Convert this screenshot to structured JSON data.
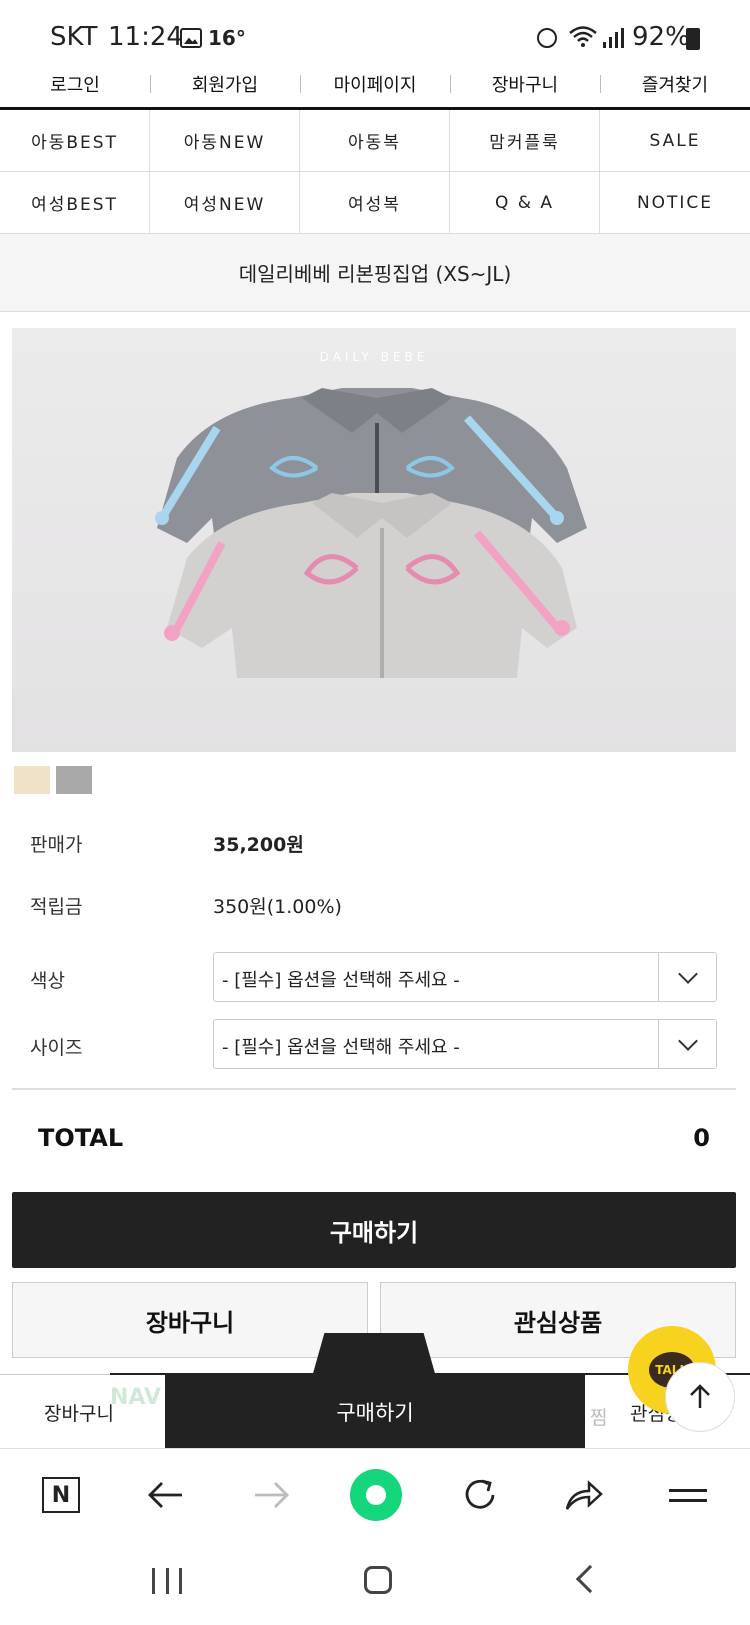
{
  "status_bar": {
    "carrier": "SKT",
    "time": "11:24",
    "temperature": "16°",
    "battery": "92%"
  },
  "top_links": [
    "로그인",
    "회원가입",
    "마이페이지",
    "장바구니",
    "즐겨찾기"
  ],
  "categories": [
    "아동BEST",
    "아동NEW",
    "아동복",
    "맘커플룩",
    "SALE",
    "여성BEST",
    "여성NEW",
    "여성복",
    "Q & A",
    "NOTICE"
  ],
  "product": {
    "title": "데일리베베 리본핑집업 (XS~JL)",
    "image_brand": "DAILY BEBE",
    "swatches": [
      "#efe2c9",
      "#a9a9a9"
    ],
    "price_label": "판매가",
    "price": "35,200원",
    "points_label": "적립금",
    "points": "350원(1.00%)",
    "color_label": "색상",
    "color_placeholder": "- [필수] 옵션을 선택해 주세요 -",
    "size_label": "사이즈",
    "size_placeholder": "- [필수] 옵션을 선택해 주세요 -",
    "total_label": "TOTAL",
    "total_value": "0"
  },
  "actions": {
    "buy": "구매하기",
    "cart": "장바구니",
    "wishlist": "관심상품"
  },
  "sticky_bar": {
    "cart": "장바구니",
    "naver": "NAV",
    "buy": "구매하기",
    "zzim": "찜",
    "wishlist": "관심상품"
  },
  "talk_button": "TALK",
  "browser_toolbar": {
    "home_letter": "N"
  },
  "colors": {
    "accent_dark": "#222222",
    "kakao_yellow": "#f7d21e",
    "naver_green": "#15d67a"
  }
}
